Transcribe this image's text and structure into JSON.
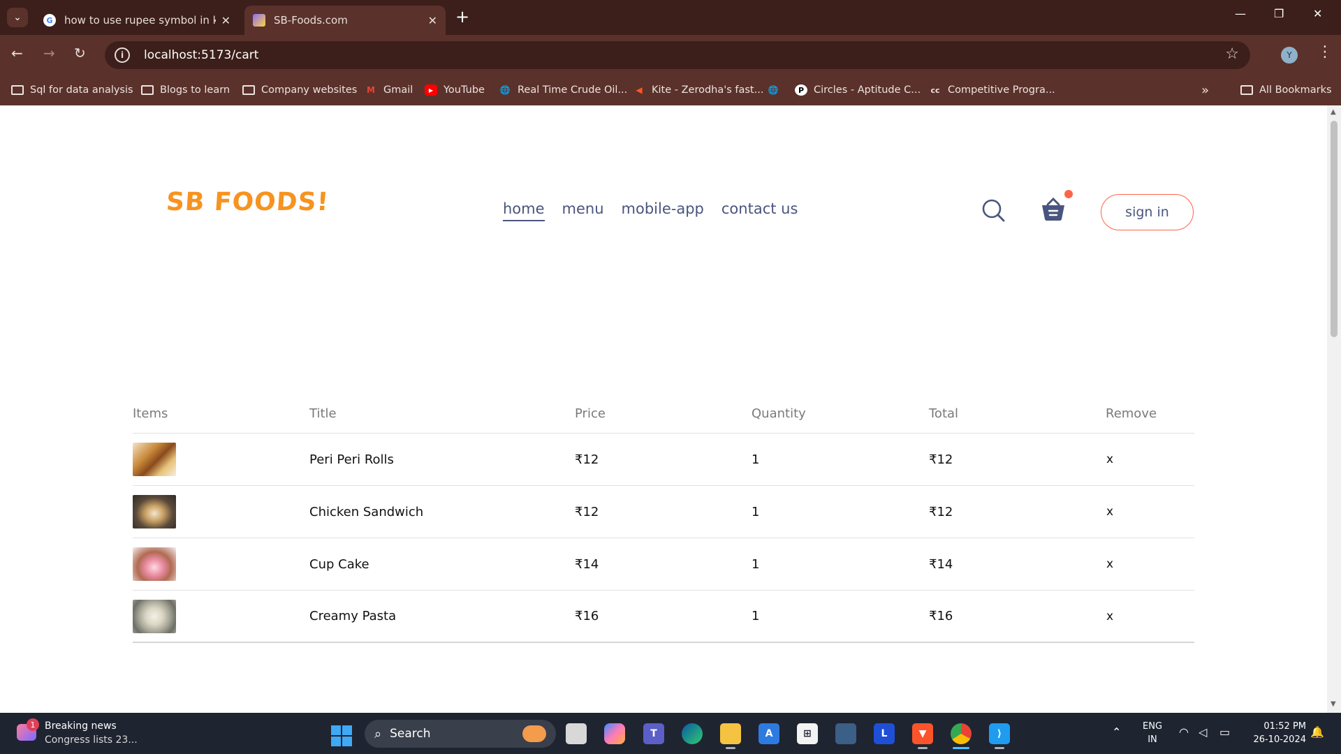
{
  "browser": {
    "tabs": [
      {
        "title": "how to use rupee symbol in key",
        "close": "✕"
      },
      {
        "title": "SB-Foods.com",
        "close": "✕"
      }
    ],
    "new_tab": "+",
    "window_controls": {
      "minimize": "—",
      "restore": "❐",
      "close": "✕"
    },
    "url": "localhost:5173/cart",
    "profile_initial": "Y",
    "bookmarks": [
      {
        "label": "Sql for data analysis",
        "icon": "folder-icon"
      },
      {
        "label": "Blogs to learn",
        "icon": "folder-icon"
      },
      {
        "label": "Company websites",
        "icon": "folder-icon"
      },
      {
        "label": "Gmail",
        "icon": "gmail-icon"
      },
      {
        "label": "YouTube",
        "icon": "youtube-icon"
      },
      {
        "label": "Real Time Crude Oil...",
        "icon": "globe-icon"
      },
      {
        "label": "Kite - Zerodha's fast...",
        "icon": "kite-icon"
      },
      {
        "label": "",
        "icon": "globe-icon"
      },
      {
        "label": "Circles - Aptitude C...",
        "icon": "circles-icon"
      },
      {
        "label": "Competitive Progra...",
        "icon": "cc-icon"
      }
    ],
    "more_bookmarks": "»",
    "all_bookmarks": "All Bookmarks"
  },
  "site": {
    "logo": "SB FOODS!",
    "nav": [
      "home",
      "menu",
      "mobile-app",
      "contact us"
    ],
    "active_nav": "home",
    "signin_label": "sign in",
    "accent_color": "#ff6347",
    "logo_color": "#f7931e"
  },
  "cart": {
    "columns": [
      "Items",
      "Title",
      "Price",
      "Quantity",
      "Total",
      "Remove"
    ],
    "rows": [
      {
        "title": "Peri Peri Rolls",
        "price": "₹12",
        "quantity": "1",
        "total": "₹12",
        "remove": "x"
      },
      {
        "title": "Chicken Sandwich",
        "price": "₹12",
        "quantity": "1",
        "total": "₹12",
        "remove": "x"
      },
      {
        "title": "Cup Cake",
        "price": "₹14",
        "quantity": "1",
        "total": "₹14",
        "remove": "x"
      },
      {
        "title": "Creamy Pasta",
        "price": "₹16",
        "quantity": "1",
        "total": "₹16",
        "remove": "x"
      }
    ]
  },
  "taskbar": {
    "news_badge": "1",
    "news_title": "Breaking news",
    "news_sub": "Congress lists 23...",
    "search_label": "Search",
    "lang_top": "ENG",
    "lang_bottom": "IN",
    "time": "01:52 PM",
    "date": "26-10-2024"
  }
}
